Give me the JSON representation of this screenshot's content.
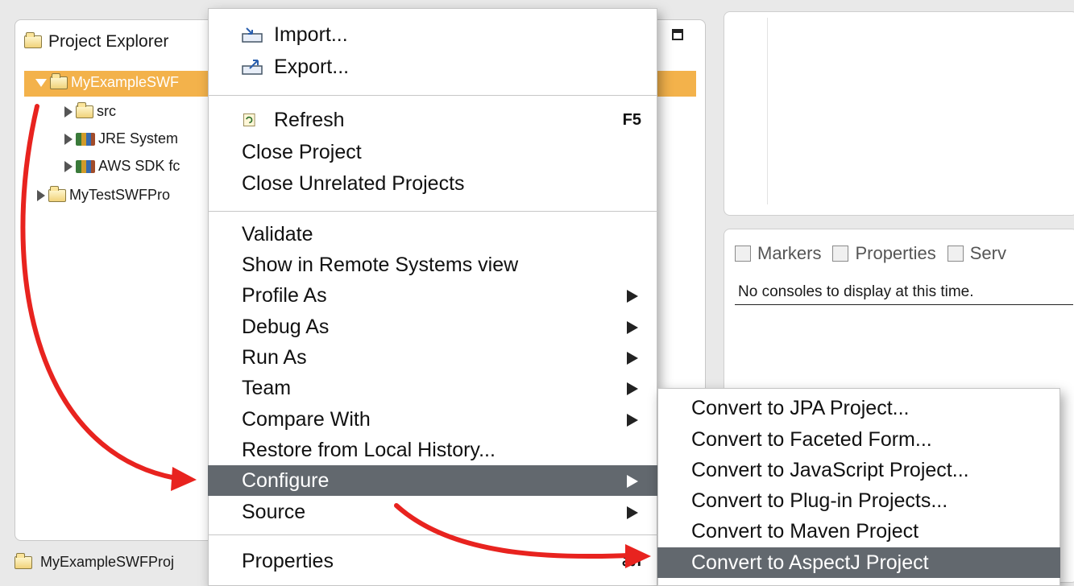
{
  "explorer": {
    "title": "Project Explorer",
    "tree": [
      {
        "label": "MyExampleSWF",
        "icon": "project-folder-icon",
        "expanded": true,
        "selected": true
      },
      {
        "label": "src",
        "icon": "package-folder-icon"
      },
      {
        "label": "JRE System",
        "icon": "library-icon"
      },
      {
        "label": "AWS SDK fc",
        "icon": "library-icon"
      },
      {
        "label": "MyTestSWFPro",
        "icon": "project-folder-icon"
      }
    ]
  },
  "status": {
    "label": "MyExampleSWFProj"
  },
  "console": {
    "tabs": [
      {
        "label": "Markers",
        "icon": "markers-icon"
      },
      {
        "label": "Properties",
        "icon": "properties-icon"
      },
      {
        "label": "Serv",
        "icon": "servers-icon"
      }
    ],
    "message": "No consoles to display at this time."
  },
  "menu": {
    "items": [
      {
        "label": "Import...",
        "icon": "import-icon"
      },
      {
        "label": "Export...",
        "icon": "export-icon"
      },
      {
        "label": "Refresh",
        "icon": "refresh-icon",
        "accelerator": "F5"
      },
      {
        "label": "Close Project"
      },
      {
        "label": "Close Unrelated Projects"
      },
      {
        "label": "Validate"
      },
      {
        "label": "Show in Remote Systems view"
      },
      {
        "label": "Profile As",
        "submenu": true
      },
      {
        "label": "Debug As",
        "submenu": true
      },
      {
        "label": "Run As",
        "submenu": true
      },
      {
        "label": "Team",
        "submenu": true
      },
      {
        "label": "Compare With",
        "submenu": true
      },
      {
        "label": "Restore from Local History..."
      },
      {
        "label": "Configure",
        "submenu": true,
        "highlighted": true
      },
      {
        "label": "Source",
        "submenu": true
      },
      {
        "label": "Properties",
        "accelerator": "⌘I"
      }
    ]
  },
  "submenu": {
    "items": [
      {
        "label": "Convert to JPA Project..."
      },
      {
        "label": "Convert to Faceted Form..."
      },
      {
        "label": "Convert to JavaScript Project..."
      },
      {
        "label": "Convert to Plug-in Projects..."
      },
      {
        "label": "Convert to Maven Project"
      },
      {
        "label": "Convert to AspectJ Project",
        "highlighted": true
      }
    ]
  },
  "colors": {
    "selection": "#f3b24b",
    "menu_highlight": "#62686e",
    "annotation_arrow": "#e8231f"
  }
}
